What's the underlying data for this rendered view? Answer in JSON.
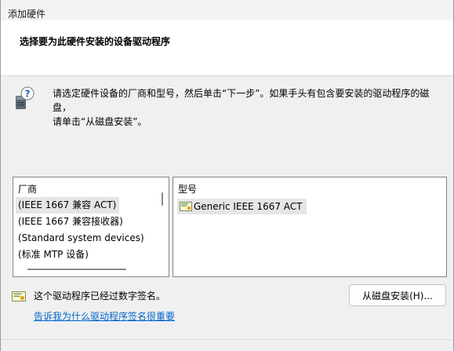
{
  "window": {
    "title": "添加硬件"
  },
  "header": {
    "title": "选择要为此硬件安装的设备驱动程序"
  },
  "instruction": {
    "line1": "请选定硬件设备的厂商和型号，然后单击“下一步”。如果手头有包含要安装的驱动程序的磁盘，",
    "line2": "请单击“从磁盘安装”。",
    "icon": "hardware-question-icon"
  },
  "manufacturer_list": {
    "header": "厂商",
    "items": [
      {
        "label": "(IEEE 1667 兼容 ACT)",
        "selected": true
      },
      {
        "label": "(IEEE 1667 兼容接收器)",
        "selected": false
      },
      {
        "label": "(Standard system devices)",
        "selected": false
      },
      {
        "label": "(标准 MTP 设备)",
        "selected": false
      }
    ]
  },
  "model_list": {
    "header": "型号",
    "items": [
      {
        "label": "Generic IEEE 1667 ACT",
        "icon": "certificate-icon",
        "selected": true
      }
    ]
  },
  "signature": {
    "text": "这个驱动程序已经过数字签名。",
    "icon": "certificate-icon",
    "link": "告诉我为什么驱动程序签名很重要"
  },
  "buttons": {
    "have_disk": "从磁盘安装(H)..."
  },
  "colors": {
    "link": "#0066cc",
    "selection": "#e5e5e5",
    "header_band": "#ffffff",
    "dialog_bg": "#f0f0f0"
  }
}
